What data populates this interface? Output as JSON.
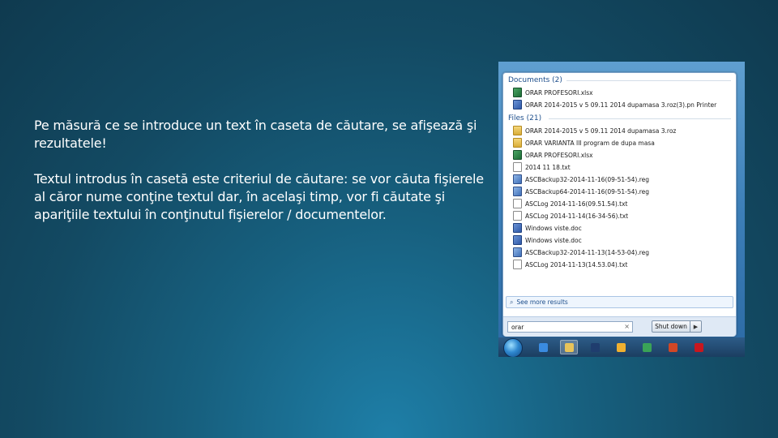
{
  "slide": {
    "paragraph1": "Pe măsură ce se introduce un text în caseta de căutare, se afişează şi rezultatele!",
    "paragraph2": "Textul introdus în casetă este criteriul de căutare: se vor căuta fişierele al căror nume conţine textul dar, în acelaşi timp, vor fi căutate şi apariţiile textului în conţinutul fişierelor / documentelor."
  },
  "start_menu": {
    "documents_header": "Documents (2)",
    "documents": [
      {
        "name": "ORAR PROFESORI.xlsx",
        "icon": "excel-icon"
      },
      {
        "name": "ORAR 2014-2015 v 5 09.11 2014 dupamasa 3.roz(3).pn Printer",
        "icon": "word-icon"
      }
    ],
    "files_header": "Files (21)",
    "files": [
      {
        "name": "ORAR 2014-2015 v 5 09.11 2014 dupamasa 3.roz",
        "icon": "folder-icon"
      },
      {
        "name": "ORAR VARIANTA III program de dupa masa",
        "icon": "folder-icon"
      },
      {
        "name": "ORAR PROFESORI.xlsx",
        "icon": "excel-icon"
      },
      {
        "name": "2014 11 18.txt",
        "icon": "text-file-icon"
      },
      {
        "name": "ASCBackup32-2014-11-16(09-51-54).reg",
        "icon": "registry-icon"
      },
      {
        "name": "ASCBackup64-2014-11-16(09-51-54).reg",
        "icon": "registry-icon"
      },
      {
        "name": "ASCLog 2014-11-16(09.51.54).txt",
        "icon": "text-file-icon"
      },
      {
        "name": "ASCLog 2014-11-14(16-34-56).txt",
        "icon": "text-file-icon"
      },
      {
        "name": "Windows viste.doc",
        "icon": "word-icon"
      },
      {
        "name": "Windows viste.doc",
        "icon": "word-icon"
      },
      {
        "name": "ASCBackup32-2014-11-13(14-53-04).reg",
        "icon": "registry-icon"
      },
      {
        "name": "ASCLog 2014-11-13(14.53.04).txt",
        "icon": "text-file-icon"
      }
    ],
    "see_more": "See more results",
    "search_value": "orar",
    "search_clear": "×",
    "shutdown_label": "Shut down",
    "shutdown_arrow": "▶"
  },
  "taskbar": {
    "items": [
      {
        "name": "internet-explorer-icon",
        "color": "#3a8be0"
      },
      {
        "name": "windows-explorer-icon",
        "color": "#e8c35a",
        "active": true
      },
      {
        "name": "media-player-icon",
        "color": "#1f3d6e"
      },
      {
        "name": "app-icon",
        "color": "#f0b030"
      },
      {
        "name": "chrome-icon",
        "color": "#3aa357"
      },
      {
        "name": "powerpoint-icon",
        "color": "#d24726"
      },
      {
        "name": "adobe-reader-icon",
        "color": "#c8171e"
      }
    ]
  }
}
